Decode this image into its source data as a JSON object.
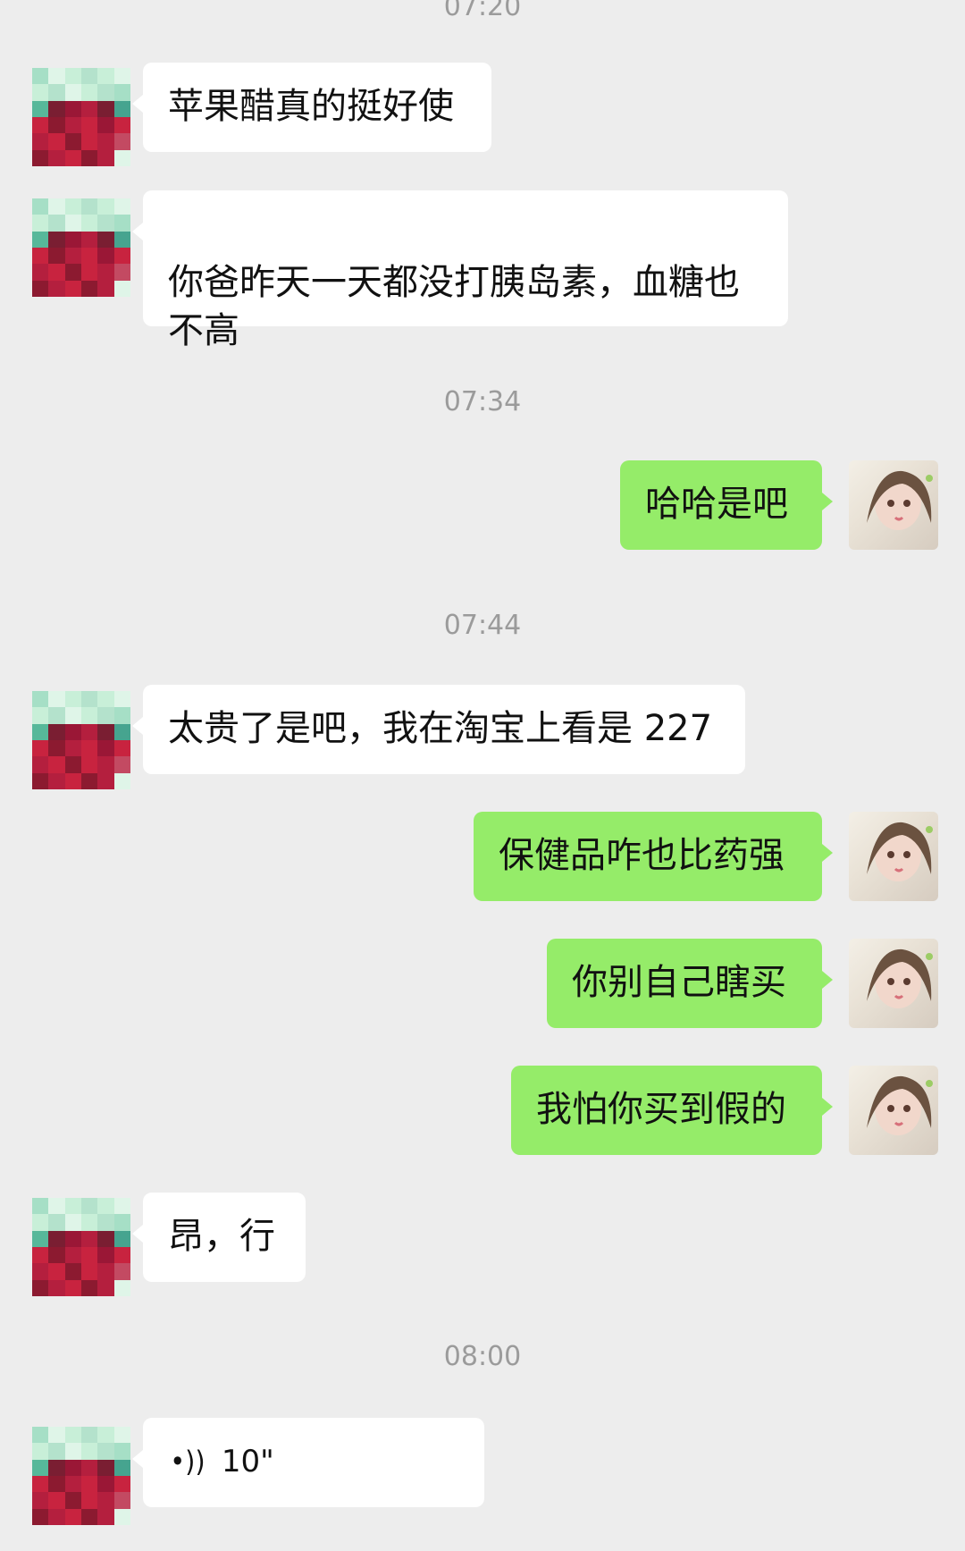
{
  "timestamps": [
    "07:20",
    "07:34",
    "07:44",
    "08:00"
  ],
  "messages": [
    {
      "side": "left",
      "text": "苹果醋真的挺好使"
    },
    {
      "side": "left",
      "text": "你爸昨天一天都没打胰岛素，血糖也\n不高"
    },
    {
      "side": "right",
      "text": "哈哈是吧"
    },
    {
      "side": "left",
      "text": "太贵了是吧，我在淘宝上看是 227"
    },
    {
      "side": "right",
      "text": "保健品咋也比药强"
    },
    {
      "side": "right",
      "text": "你别自己瞎买"
    },
    {
      "side": "right",
      "text": "我怕你买到假的"
    },
    {
      "side": "left",
      "text": "昂，行"
    },
    {
      "side": "left",
      "voice": true,
      "duration": "10\""
    }
  ],
  "colors": {
    "background": "#ededed",
    "incoming_bubble": "#ffffff",
    "outgoing_bubble": "#95ec69",
    "timestamp": "#9b9b9b"
  }
}
